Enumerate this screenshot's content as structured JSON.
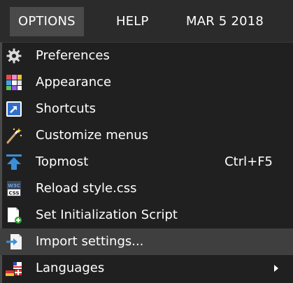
{
  "menubar": {
    "options_label": "OPTIONS",
    "help_label": "HELP",
    "date_label": "MAR 5 2018"
  },
  "menu": {
    "items": [
      {
        "label": "Preferences",
        "icon": "gear-icon",
        "shortcut": ""
      },
      {
        "label": "Appearance",
        "icon": "palette-icon",
        "shortcut": ""
      },
      {
        "label": "Shortcuts",
        "icon": "shortcut-arrow-icon",
        "shortcut": ""
      },
      {
        "label": "Customize menus",
        "icon": "magic-wand-icon",
        "shortcut": ""
      },
      {
        "label": "Topmost",
        "icon": "topmost-arrow-icon",
        "shortcut": "Ctrl+F5"
      },
      {
        "label": "Reload style.css",
        "icon": "css-file-icon",
        "shortcut": ""
      },
      {
        "label": "Set Initialization Script",
        "icon": "script-add-icon",
        "shortcut": ""
      },
      {
        "label": "Import settings...",
        "icon": "import-icon",
        "shortcut": ""
      },
      {
        "label": "Languages",
        "icon": "flags-icon",
        "shortcut": "",
        "submenu": true
      }
    ],
    "hovered_index": 7,
    "css_icon_text": "CSS",
    "w3c_icon_text": "W3C"
  },
  "colors": {
    "background": "#2b2b2b",
    "menu_background": "#202020",
    "hover_background": "#3f3f3f",
    "active_top_background": "#4a4a4a",
    "text": "#ffffff",
    "topmost_blue": "#3b8fd9",
    "shortcut_blue": "#2f6fc9"
  }
}
